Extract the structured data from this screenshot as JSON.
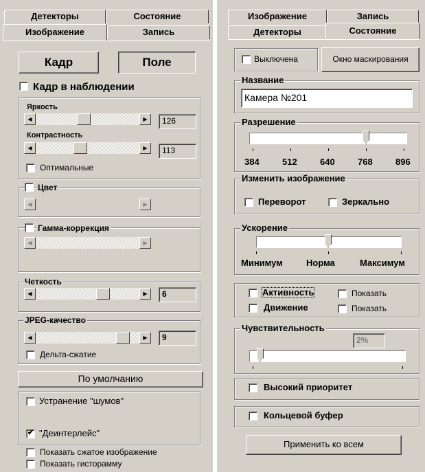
{
  "left": {
    "tabs_back": [
      "Детекторы",
      "Состояние"
    ],
    "tabs_front": [
      "Изображение",
      "Запись"
    ],
    "btn_frame": "Кадр",
    "btn_field": "Поле",
    "frame_observe": "Кадр в наблюдении",
    "brightness_label": "Яркость",
    "brightness_value": "126",
    "brightness_level": 0.46,
    "contrast_label": "Контрастность",
    "contrast_value": "113",
    "contrast_level": 0.42,
    "optimal_label": "Оптимальные",
    "color_label": "Цвет",
    "gamma_label": "Гамма-коррекция",
    "sharpness_label": "Четкость",
    "sharpness_value": "6",
    "sharpness_level": 0.67,
    "jpeg_label": "JPEG-качество",
    "jpeg_value": "9",
    "jpeg_level": 0.89,
    "delta_label": "Дельта-сжатие",
    "default_btn": "По умолчанию",
    "noise_label": "Устранение \"шумов\"",
    "noise_checked": false,
    "deinterlace_label": "\"Деинтерлейс\"",
    "deinterlace_checked": true,
    "show_compressed": "Показать сжатое изображение",
    "show_histogram": "Показать гисторамму"
  },
  "right": {
    "tabs_back": [
      "Изображение",
      "Запись"
    ],
    "tabs_front": [
      "Детекторы",
      "Состояние"
    ],
    "disabled_label": "Выключена",
    "mask_window_btn": "Окно маскирования",
    "name_group": "Название",
    "name_value": "Камера №201",
    "resolution_group": "Разрешение",
    "resolution_ticks": [
      "384",
      "512",
      "640",
      "768",
      "896"
    ],
    "resolution_value": "768",
    "change_image_group": "Изменить изображение",
    "flip_label": "Переворот",
    "mirror_label": "Зеркально",
    "accel_group": "Ускорение",
    "accel_labels": [
      "Минимум",
      "Норма",
      "Максимум"
    ],
    "accel_value": "Норма",
    "activity_label": "Активность",
    "motion_label": "Движение",
    "show_label_1": "Показать",
    "show_label_2": "Показать",
    "sensitivity_group": "Чувствительность",
    "sensitivity_value": "2%",
    "high_priority": "Высокий приоритет",
    "ring_buffer": "Кольцевой буфер",
    "apply_all_btn": "Применить ко всем"
  }
}
